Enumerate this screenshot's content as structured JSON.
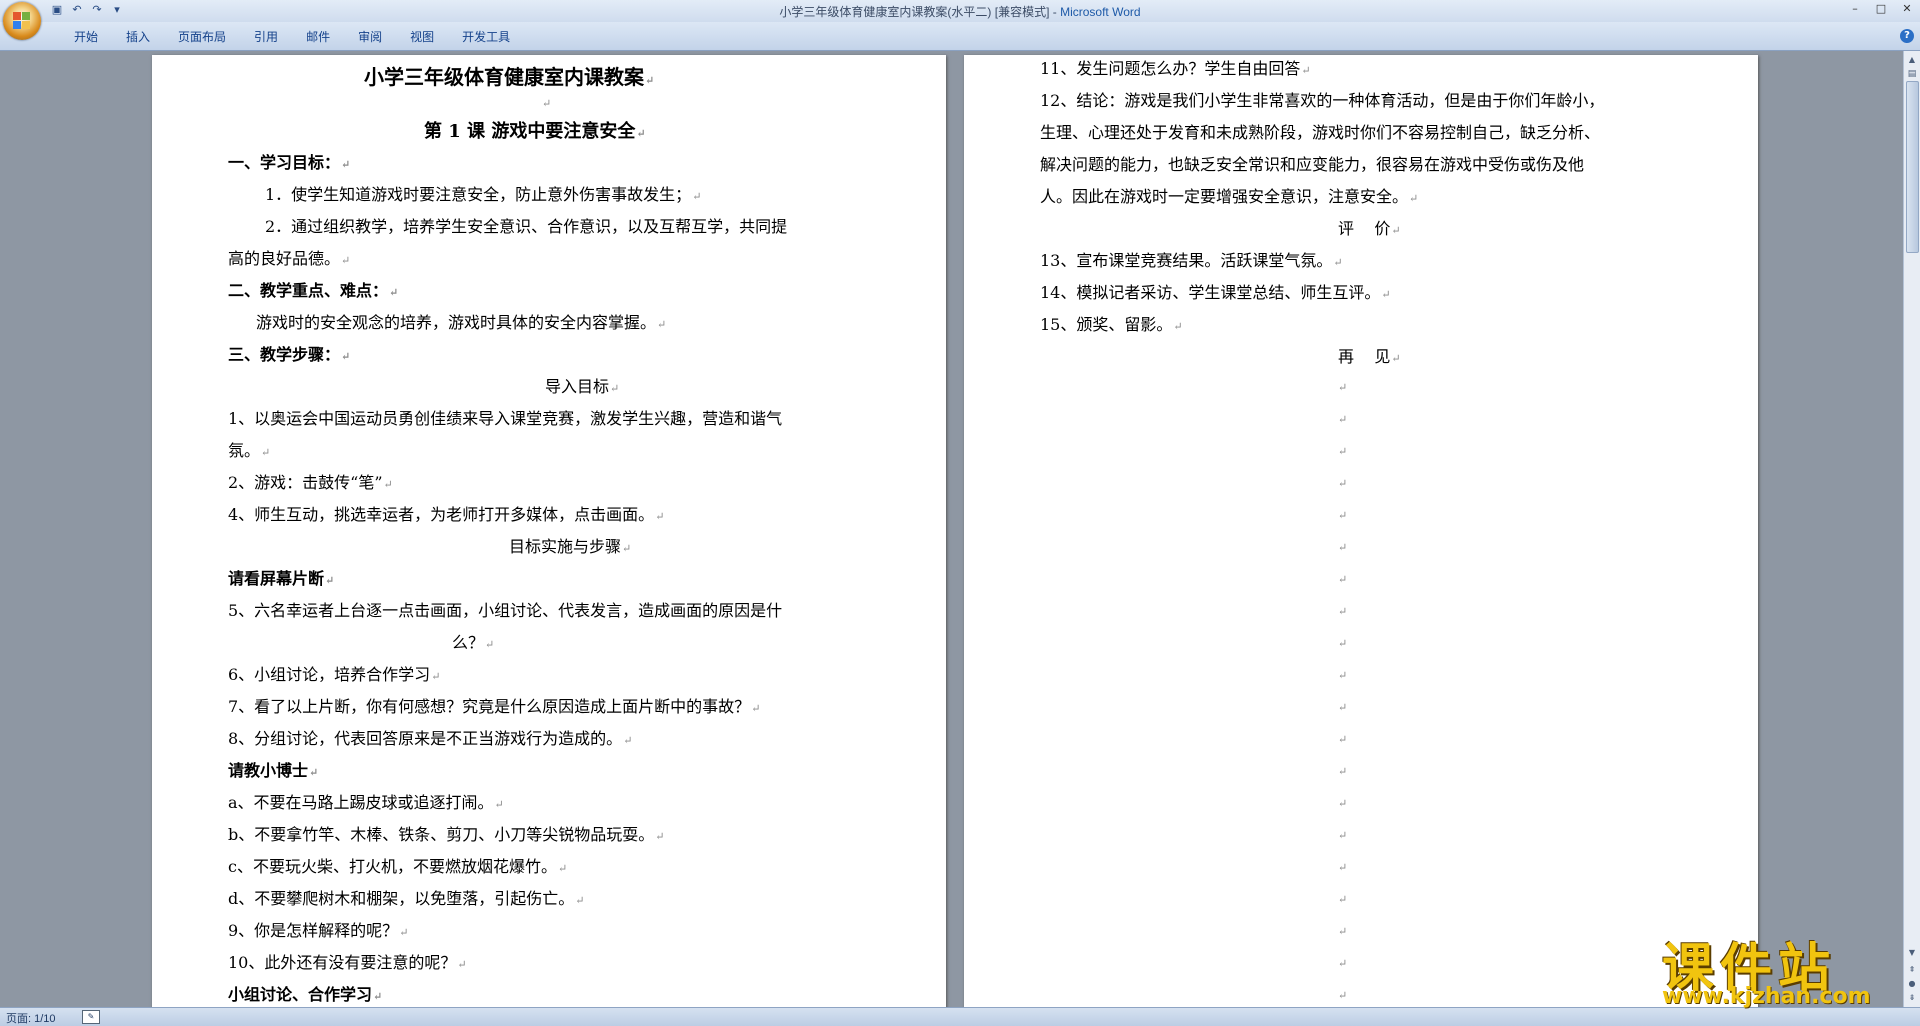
{
  "window": {
    "doc_title": "小学三年级体育健康室内课教案(水平二) [兼容模式] - ",
    "app_name": "Microsoft Word",
    "controls": [
      "–",
      "□",
      "✕"
    ]
  },
  "qat": {
    "icons": [
      "save-icon",
      "undo-icon",
      "redo-icon",
      "customize-icon"
    ]
  },
  "ribbon": {
    "tabs": [
      "开始",
      "插入",
      "页面布局",
      "引用",
      "邮件",
      "审阅",
      "视图",
      "开发工具"
    ]
  },
  "left_page": {
    "title": "小学三年级体育健康室内课教案",
    "lesson": "第 1 课  游戏中要注意安全",
    "h1": "一、学习目标：",
    "goal1": "1．使学生知道游戏时要注意安全，防止意外伤害事故发生；",
    "goal2a": "2．通过组织教学，培养学生安全意识、合作意识，以及互帮互学，共同提",
    "goal2b": "高的良好品德。",
    "h2": "二、教学重点、难点：",
    "key": "游戏时的安全观念的培养，游戏时具体的安全内容掌握。",
    "h3": "三、教学步骤：",
    "sub1": "导入目标",
    "s1a": "1、以奥运会中国运动员勇创佳绩来导入课堂竞赛，激发学生兴趣，营造和谐气",
    "s1b": "氛。",
    "s2": "2、游戏：击鼓传“笔”",
    "s4": "4、师生互动，挑选幸运者，为老师打开多媒体，点击画面。",
    "sub2": "目标实施与步骤",
    "bold1": "请看屏幕片断",
    "s5a": "5、六名幸运者上台逐一点击画面，小组讨论、代表发言，造成画面的原因是什",
    "s5b": "么？",
    "s6": "6、小组讨论，培养合作学习",
    "s7": "7、看了以上片断，你有何感想？究竟是什么原因造成上面片断中的事故？",
    "s8": "8、分组讨论，代表回答原来是不正当游戏行为造成的。",
    "bold2": "请教小博士",
    "a": "a、不要在马路上踢皮球或追逐打闹。",
    "b": "b、不要拿竹竿、木棒、铁条、剪刀、小刀等尖锐物品玩耍。",
    "c": "c、不要玩火柴、打火机，不要燃放烟花爆竹。",
    "d": "d、不要攀爬树木和棚架，以免堕落，引起伤亡。",
    "s9": "9、你是怎样解释的呢？",
    "s10": "10、此外还有没有要注意的呢？",
    "bold3": "小组讨论、合作学习"
  },
  "right_page": {
    "s11": "11、发生问题怎么办？学生自由回答",
    "s12a": "12、结论：游戏是我们小学生非常喜欢的一种体育活动，但是由于你们年龄小，",
    "s12b": "生理、心理还处于发育和未成熟阶段，游戏时你们不容易控制自己，缺乏分析、",
    "s12c": "解决问题的能力，也缺乏安全常识和应变能力，很容易在游戏中受伤或伤及他",
    "s12d": "人。因此在游戏时一定要增强安全意识，注意安全。",
    "eval": "评    价",
    "s13": "13、宣布课堂竞赛结果。活跃课堂气氛。",
    "s14": "14、模拟记者采访、学生课堂总结、师生互评。",
    "s15": "15、颁奖、留影。",
    "bye": "再    见"
  },
  "paragraph_mark": "↵",
  "status": {
    "page": "页面: 1/10"
  },
  "watermark": {
    "title": "课件站",
    "url": "www.kjzhan.com"
  }
}
